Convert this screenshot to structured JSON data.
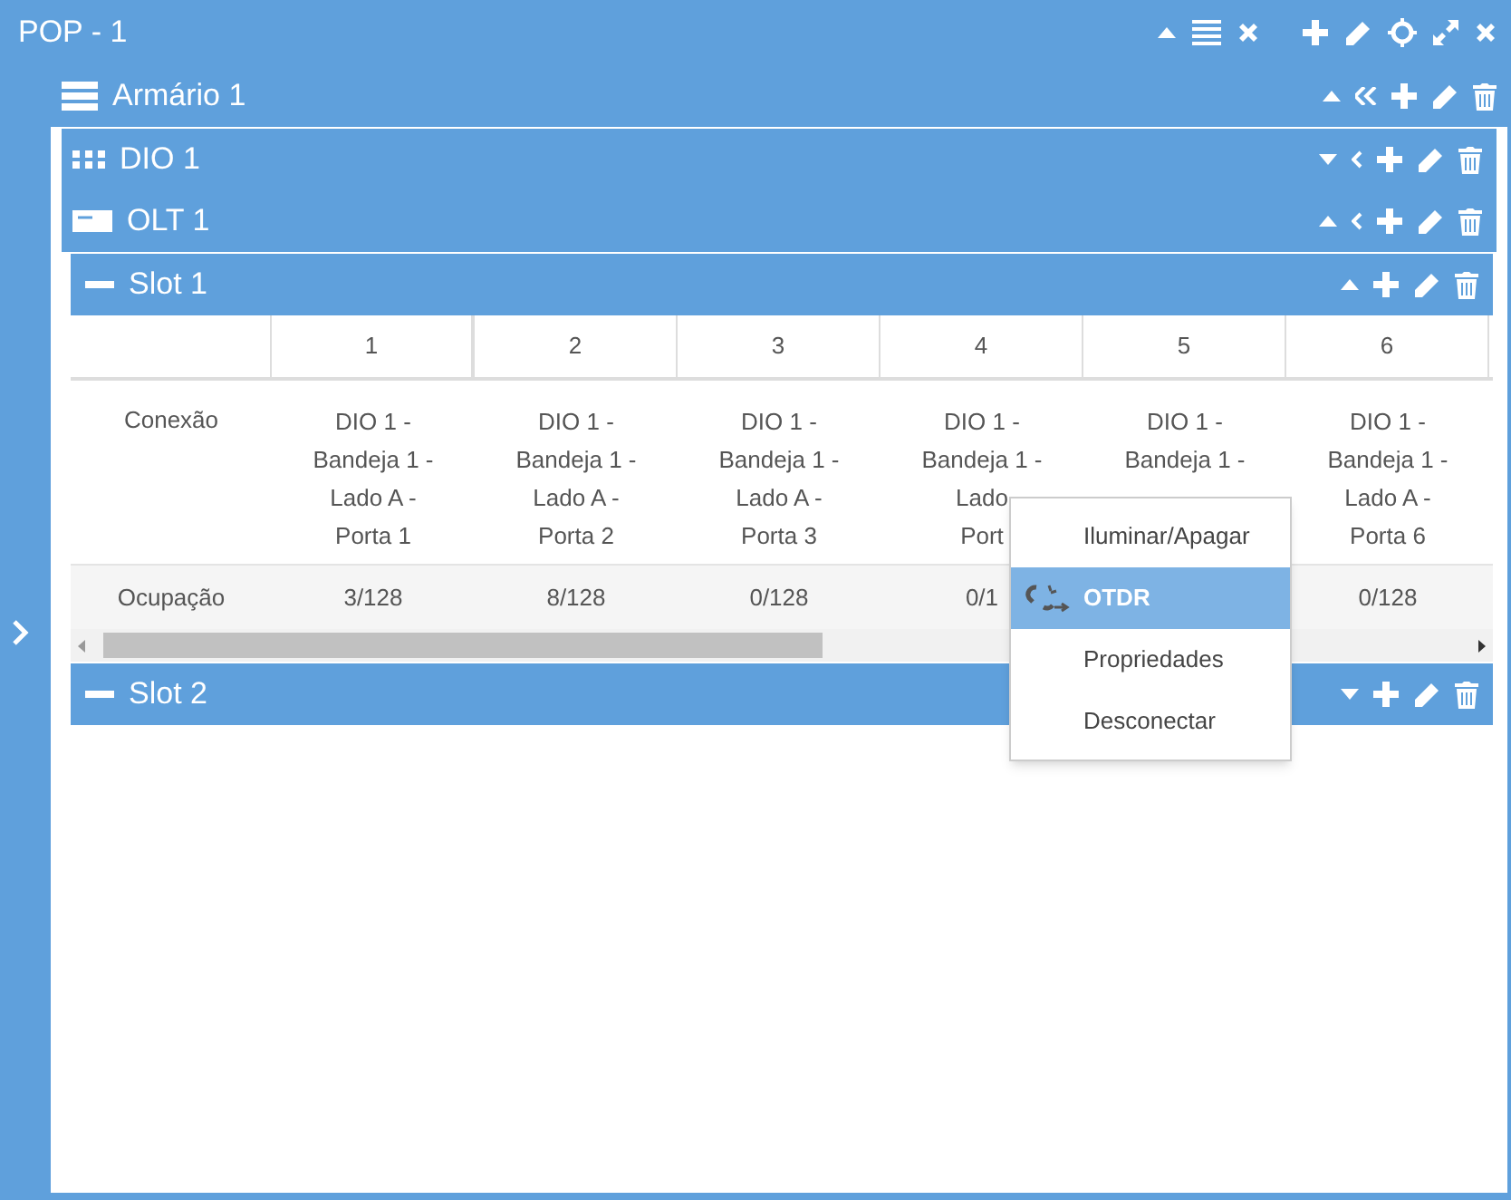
{
  "pop": {
    "title": "POP - 1",
    "expanded": true
  },
  "cabinet": {
    "title": "Armário 1",
    "expanded": true
  },
  "devices": [
    {
      "kind": "dio",
      "title": "DIO 1",
      "expanded": false
    },
    {
      "kind": "olt",
      "title": "OLT 1",
      "expanded": true
    }
  ],
  "slots": [
    {
      "title": "Slot 1",
      "expanded": true,
      "table": {
        "columns": [
          "1",
          "2",
          "3",
          "4",
          "5",
          "6"
        ],
        "rows": [
          {
            "label": "Conexão",
            "cells": [
              "DIO 1 -\nBandeja 1 -\nLado A -\nPorta 1",
              "DIO 1 -\nBandeja 1 -\nLado A -\nPorta 2",
              "DIO 1 -\nBandeja 1 -\nLado A -\nPorta 3",
              "DIO 1 -\nBandeja 1 -\nLado\nPort",
              "DIO 1 -\nBandeja 1 -",
              "DIO 1 -\nBandeja 1 -\nLado A -\nPorta 6"
            ]
          },
          {
            "label": "Ocupação",
            "cells": [
              "3/128",
              "8/128",
              "0/128",
              "0/1",
              "",
              "0/128"
            ]
          }
        ]
      }
    },
    {
      "title": "Slot 2",
      "expanded": false
    }
  ],
  "context_menu": [
    {
      "kind": "text",
      "label": "Iluminar/Apagar",
      "selected": false
    },
    {
      "kind": "icon",
      "label": "OTDR",
      "selected": true
    },
    {
      "kind": "text",
      "label": "Propriedades",
      "selected": false
    },
    {
      "kind": "text",
      "label": "Desconectar",
      "selected": false
    }
  ]
}
